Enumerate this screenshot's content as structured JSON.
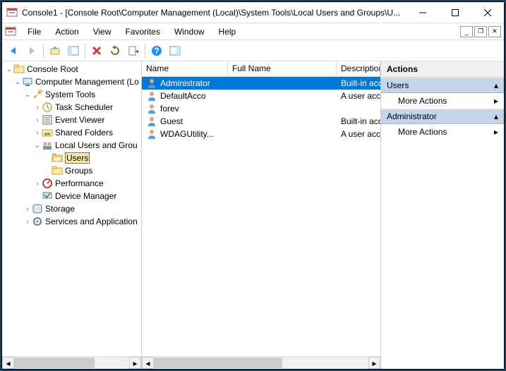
{
  "window": {
    "title": "Console1 - [Console Root\\Computer Management (Local)\\System Tools\\Local Users and Groups\\U..."
  },
  "menubar": {
    "file": "File",
    "action": "Action",
    "view": "View",
    "favorites": "Favorites",
    "window": "Window",
    "help": "Help"
  },
  "tree": {
    "root": "Console Root",
    "cm": "Computer Management (Lo",
    "systools": "System Tools",
    "tasksched": "Task Scheduler",
    "eventviewer": "Event Viewer",
    "sharedfolders": "Shared Folders",
    "lusers": "Local Users and Grou",
    "users": "Users",
    "groups": "Groups",
    "performance": "Performance",
    "devmgr": "Device Manager",
    "storage": "Storage",
    "services": "Services and Application"
  },
  "list": {
    "headers": {
      "name": "Name",
      "fullname": "Full Name",
      "desc": "Description"
    },
    "rows": [
      {
        "name": "Administrator",
        "full": "",
        "desc": "Built-in acco"
      },
      {
        "name": "DefaultAcco",
        "full": "",
        "desc": "A user acco"
      },
      {
        "name": "forev",
        "full": "",
        "desc": ""
      },
      {
        "name": "Guest",
        "full": "",
        "desc": "Built-in acco"
      },
      {
        "name": "WDAGUtility...",
        "full": "",
        "desc": "A user acco"
      }
    ]
  },
  "actions": {
    "header": "Actions",
    "section1": "Users",
    "more1": "More Actions",
    "section2": "Administrator",
    "more2": "More Actions"
  }
}
